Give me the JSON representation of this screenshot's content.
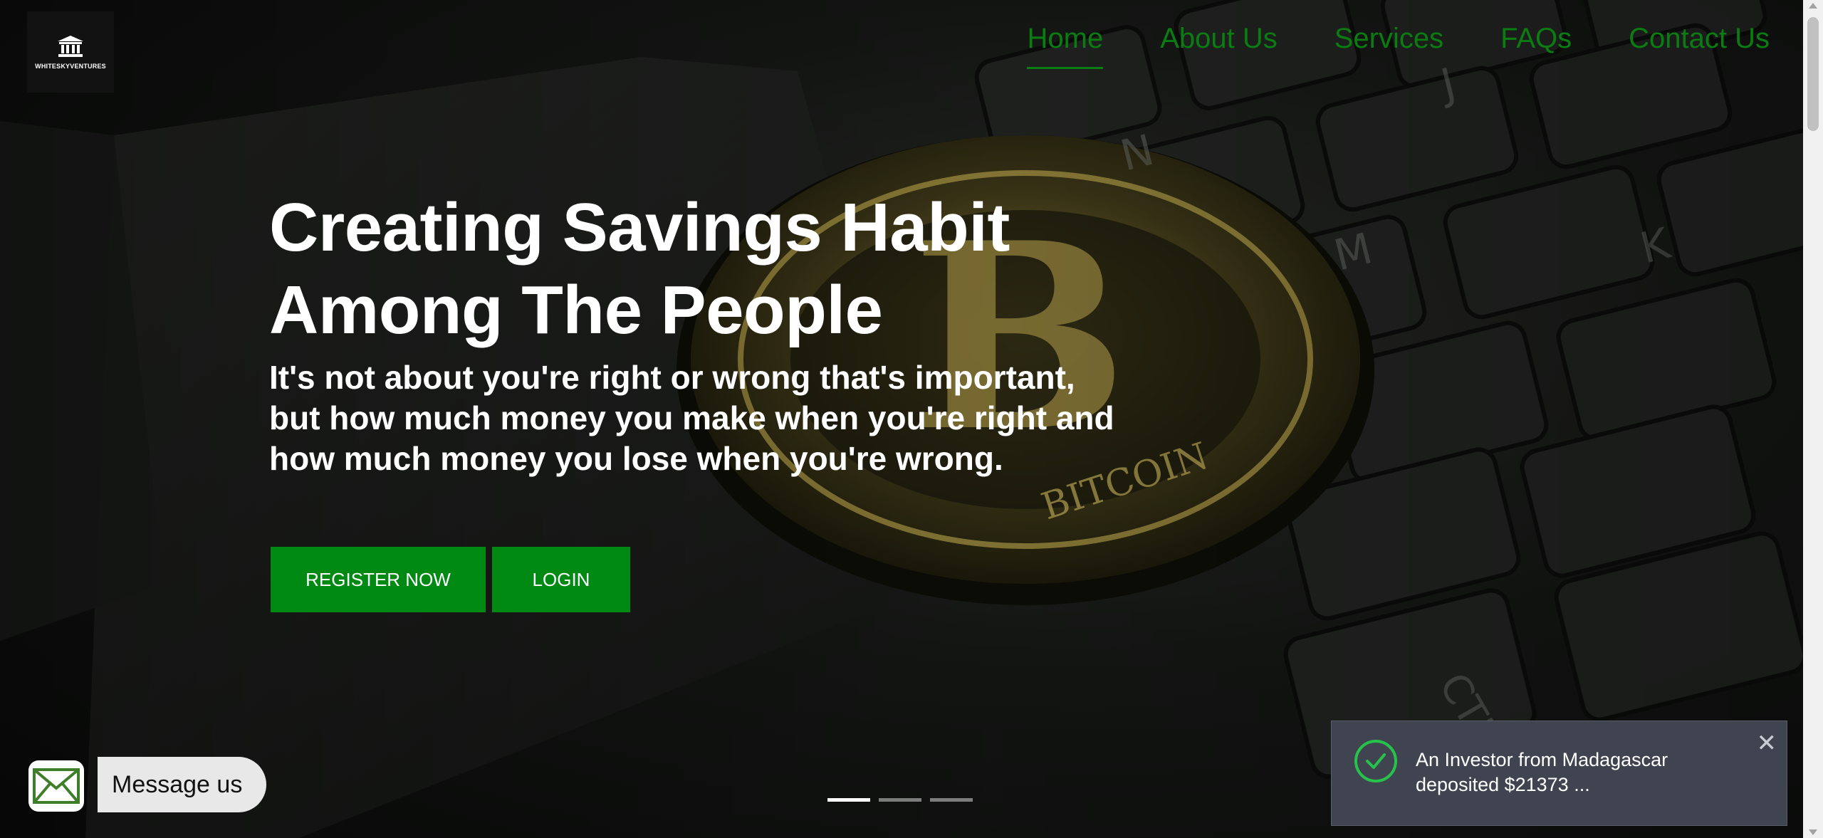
{
  "brand": {
    "logo_text": "WHITESKYVENTURES"
  },
  "nav": {
    "items": [
      {
        "label": "Home",
        "active": true
      },
      {
        "label": "About Us",
        "active": false
      },
      {
        "label": "Services",
        "active": false
      },
      {
        "label": "FAQs",
        "active": false
      },
      {
        "label": "Contact Us",
        "active": false
      }
    ]
  },
  "hero": {
    "title_line1": "Creating Savings Habit",
    "title_line2": "Among The People",
    "subtitle": "It's not about you're right or wrong that's important, but how much money you make when you're right and how much money you lose when you're wrong.",
    "register_label": "REGISTER NOW",
    "login_label": "LOGIN",
    "slides_total": 3,
    "active_slide": 1
  },
  "chat_widget": {
    "label": "Message us",
    "icon": "envelope-icon"
  },
  "toast": {
    "message": "An Investor from Madagascar deposited $21373 ...",
    "close_symbol": "✕",
    "icon": "check-circle-icon"
  },
  "colors": {
    "accent": "#008a14",
    "nav_text": "#0a7c12",
    "toast_bg": "#3f4450",
    "success": "#27c24c"
  }
}
